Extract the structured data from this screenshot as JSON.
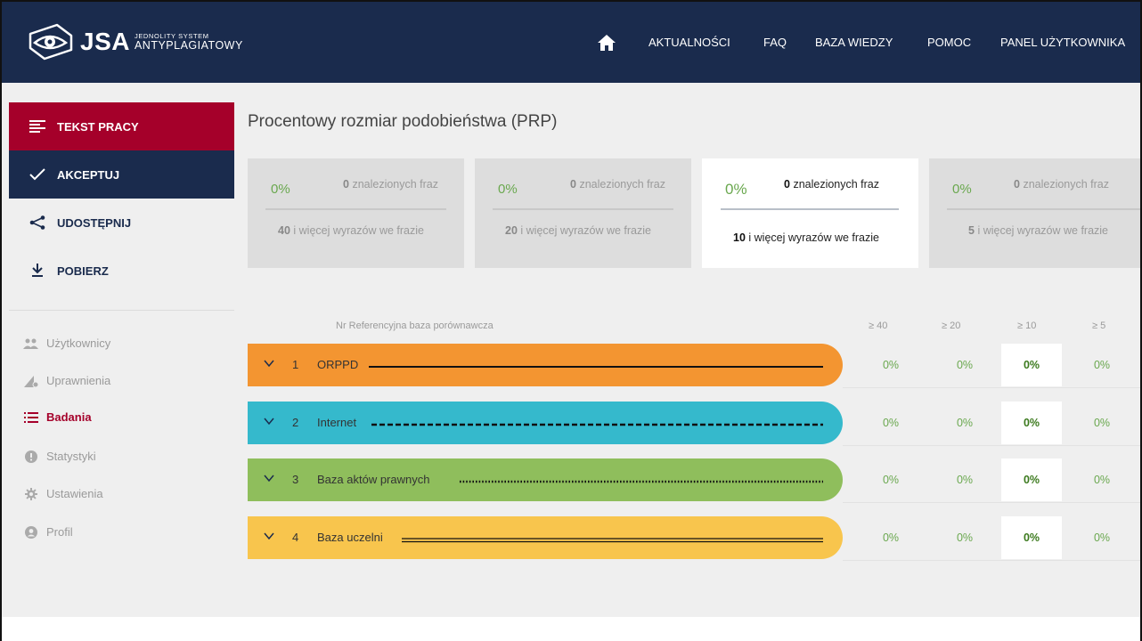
{
  "header": {
    "logo_main": "JSA",
    "logo_sub_top": "JEDNOLITY SYSTEM",
    "logo_sub_bottom": "ANTYPLAGIATOWY",
    "nav": [
      "AKTUALNOŚCI",
      "FAQ",
      "BAZA WIEDZY",
      "POMOC",
      "PANEL UŻYTKOWNIKA"
    ]
  },
  "sidebar": {
    "actions": {
      "text": "TEKST PRACY",
      "accept": "AKCEPTUJ",
      "share": "UDOSTĘPNIJ",
      "download": "POBIERZ"
    },
    "menu": [
      {
        "label": "Użytkownicy",
        "icon": "users-icon"
      },
      {
        "label": "Uprawnienia",
        "icon": "permissions-icon"
      },
      {
        "label": "Badania",
        "icon": "list-icon",
        "active": true
      },
      {
        "label": "Statystyki",
        "icon": "stats-icon"
      },
      {
        "label": "Ustawienia",
        "icon": "gear-icon"
      },
      {
        "label": "Profil",
        "icon": "profile-icon"
      }
    ]
  },
  "main": {
    "title": "Procentowy rozmiar podobieństwa (PRP)",
    "cards": [
      {
        "pct": "0%",
        "count": "0",
        "found_label": "znalezionych fraz",
        "min_words": "40",
        "words_label": "i więcej wyrazów we frazie",
        "active": false
      },
      {
        "pct": "0%",
        "count": "0",
        "found_label": "znalezionych fraz",
        "min_words": "20",
        "words_label": "i więcej wyrazów we frazie",
        "active": false
      },
      {
        "pct": "0%",
        "count": "0",
        "found_label": "znalezionych fraz",
        "min_words": "10",
        "words_label": "i więcej wyrazów we frazie",
        "active": true
      },
      {
        "pct": "0%",
        "count": "0",
        "found_label": "znalezionych fraz",
        "min_words": "5",
        "words_label": "i więcej wyrazów we frazie",
        "active": false
      }
    ],
    "table_header": {
      "label": "Nr Referencyjna baza porównawcza",
      "cols": [
        "≥ 40",
        "≥ 20",
        "≥ 10",
        "≥ 5"
      ]
    },
    "rows": [
      {
        "nr": "1",
        "name": "ORPPD",
        "color": "#f39531",
        "line": "solid",
        "values": [
          "0%",
          "0%",
          "0%",
          "0%"
        ]
      },
      {
        "nr": "2",
        "name": "Internet",
        "color": "#35b9cc",
        "line": "dashed",
        "values": [
          "0%",
          "0%",
          "0%",
          "0%"
        ]
      },
      {
        "nr": "3",
        "name": "Baza aktów prawnych",
        "color": "#8fbe5c",
        "line": "dotted",
        "values": [
          "0%",
          "0%",
          "0%",
          "0%"
        ]
      },
      {
        "nr": "4",
        "name": "Baza uczelni",
        "color": "#f8c54d",
        "line": "double",
        "values": [
          "0%",
          "0%",
          "0%",
          "0%"
        ]
      }
    ]
  },
  "colors": {
    "navy": "#1a2b4d",
    "crimson": "#a5002a",
    "green": "#6aa84f"
  }
}
